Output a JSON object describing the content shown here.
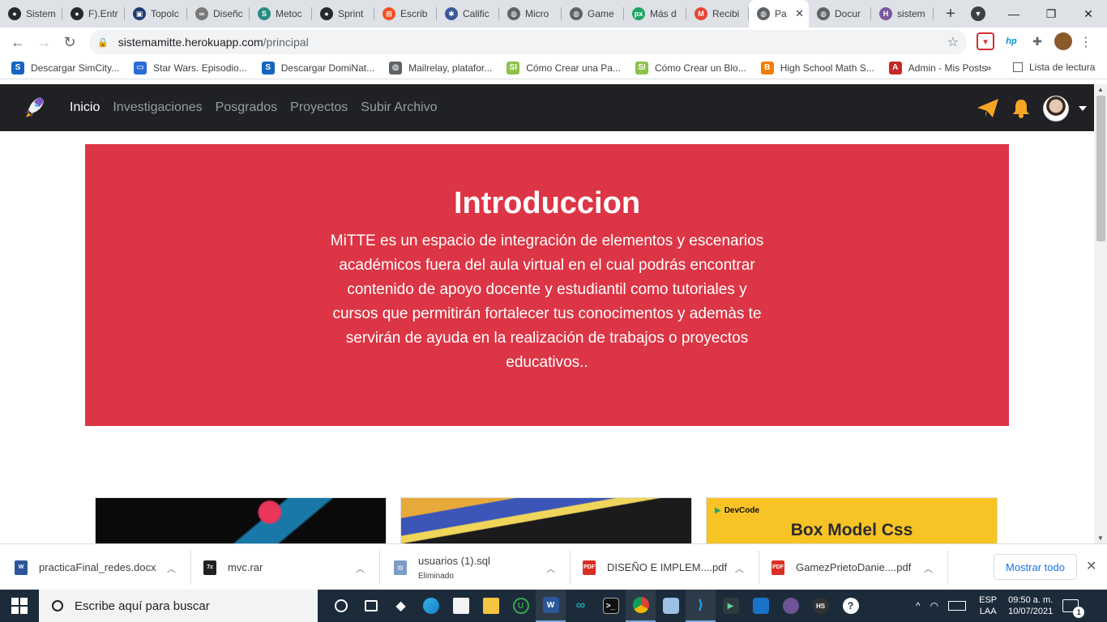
{
  "browser": {
    "tabs": [
      {
        "title": "Sistem",
        "icon": "github-icon",
        "color": "#24292e"
      },
      {
        "title": "F).Entr",
        "icon": "github-icon",
        "color": "#24292e"
      },
      {
        "title": "Topolc",
        "icon": "image-icon",
        "color": "#1f3b73"
      },
      {
        "title": "Diseñc",
        "icon": "link-icon",
        "color": "#7a7a7a"
      },
      {
        "title": "Metoc",
        "icon": "s-icon",
        "color": "#2a8c82"
      },
      {
        "title": "Sprint",
        "icon": "github-icon",
        "color": "#24292e"
      },
      {
        "title": "Escrib",
        "icon": "windows-icon",
        "color": "#f25022"
      },
      {
        "title": "Calific",
        "icon": "gear-icon",
        "color": "#3b5998"
      },
      {
        "title": "Micro",
        "icon": "globe-icon",
        "color": "#5f6368"
      },
      {
        "title": "Game",
        "icon": "globe-icon",
        "color": "#5f6368"
      },
      {
        "title": "Más d",
        "icon": "px-icon",
        "color": "#21a366"
      },
      {
        "title": "Recibi",
        "icon": "gmail-icon",
        "color": "#ea4335"
      },
      {
        "title": "Pa",
        "icon": "globe-icon",
        "color": "#5f6368",
        "active": true
      },
      {
        "title": "Docur",
        "icon": "globe-icon",
        "color": "#5f6368"
      },
      {
        "title": "sistem",
        "icon": "heroku-icon",
        "color": "#79589f"
      }
    ],
    "new_tab": "+",
    "window_controls": {
      "minimize": "—",
      "restore": "❐",
      "close": "✕"
    },
    "url_host": "sistemamitte.herokuapp.com",
    "url_path": "/principal",
    "bookmarks": [
      {
        "label": "Descargar SimCity...",
        "icon": "s-icon",
        "color": "#1565c0"
      },
      {
        "label": "Star Wars. Episodio...",
        "icon": "tv-icon",
        "color": "#2b6bd6"
      },
      {
        "label": "Descargar DomiNat...",
        "icon": "s-icon",
        "color": "#1565c0"
      },
      {
        "label": "Mailrelay, platafor...",
        "icon": "globe-icon",
        "color": "#5f6368"
      },
      {
        "label": "Cómo Crear una Pa...",
        "icon": "si-icon",
        "color": "#8bc34a"
      },
      {
        "label": "Cómo Crear un Blo...",
        "icon": "si-icon",
        "color": "#8bc34a"
      },
      {
        "label": "High School Math S...",
        "icon": "blogger-icon",
        "color": "#f57c00"
      },
      {
        "label": "Admin - Mis Posts",
        "icon": "admin-icon",
        "color": "#c62828"
      }
    ],
    "bookmarks_more": "»",
    "reading_list": "Lista de lectura"
  },
  "navbar": {
    "links": [
      {
        "label": "Inicio",
        "active": true
      },
      {
        "label": "Investigaciones",
        "active": false
      },
      {
        "label": "Posgrados",
        "active": false
      },
      {
        "label": "Proyectos",
        "active": false
      },
      {
        "label": "Subir Archivo",
        "active": false
      }
    ]
  },
  "hero": {
    "title": "Introduccion",
    "text": "MiTTE es un espacio de integración de elementos y escenarios académicos fuera del aula virtual en el cual podrás encontrar contenido de apoyo docente y estudiantil como tutoriales y cursos que permitirán fortalecer tus conocimentos y ademàs te servirán de ayuda en la realización de trabajos o proyectos educativos..",
    "background": "#dc3545"
  },
  "cards": [
    {
      "image": "abstract art thumbnail"
    },
    {
      "image": "fractal thumbnail"
    },
    {
      "brand": "DevCode",
      "title": "Box Model Css"
    }
  ],
  "downloads": {
    "items": [
      {
        "name": "practicaFinal_redes.docx",
        "sub": "",
        "icon": "word-icon",
        "color": "#2b579a"
      },
      {
        "name": "mvc.rar",
        "sub": "",
        "icon": "7zip-icon",
        "color": "#222222"
      },
      {
        "name": "usuarios (1).sql",
        "sub": "Eliminado",
        "icon": "file-icon",
        "color": "#7a9cc6"
      },
      {
        "name": "DISEÑO E IMPLEM....pdf",
        "sub": "",
        "icon": "pdf-icon",
        "color": "#d93025"
      },
      {
        "name": "GamezPrietoDanie....pdf",
        "sub": "",
        "icon": "pdf-icon",
        "color": "#d93025"
      }
    ],
    "show_all": "Mostrar todo"
  },
  "taskbar": {
    "search_placeholder": "Escribe aquí para buscar",
    "lang_top": "ESP",
    "lang_bottom": "LAA",
    "time": "09:50 a. m.",
    "date": "10/07/2021",
    "notifications": "1"
  }
}
